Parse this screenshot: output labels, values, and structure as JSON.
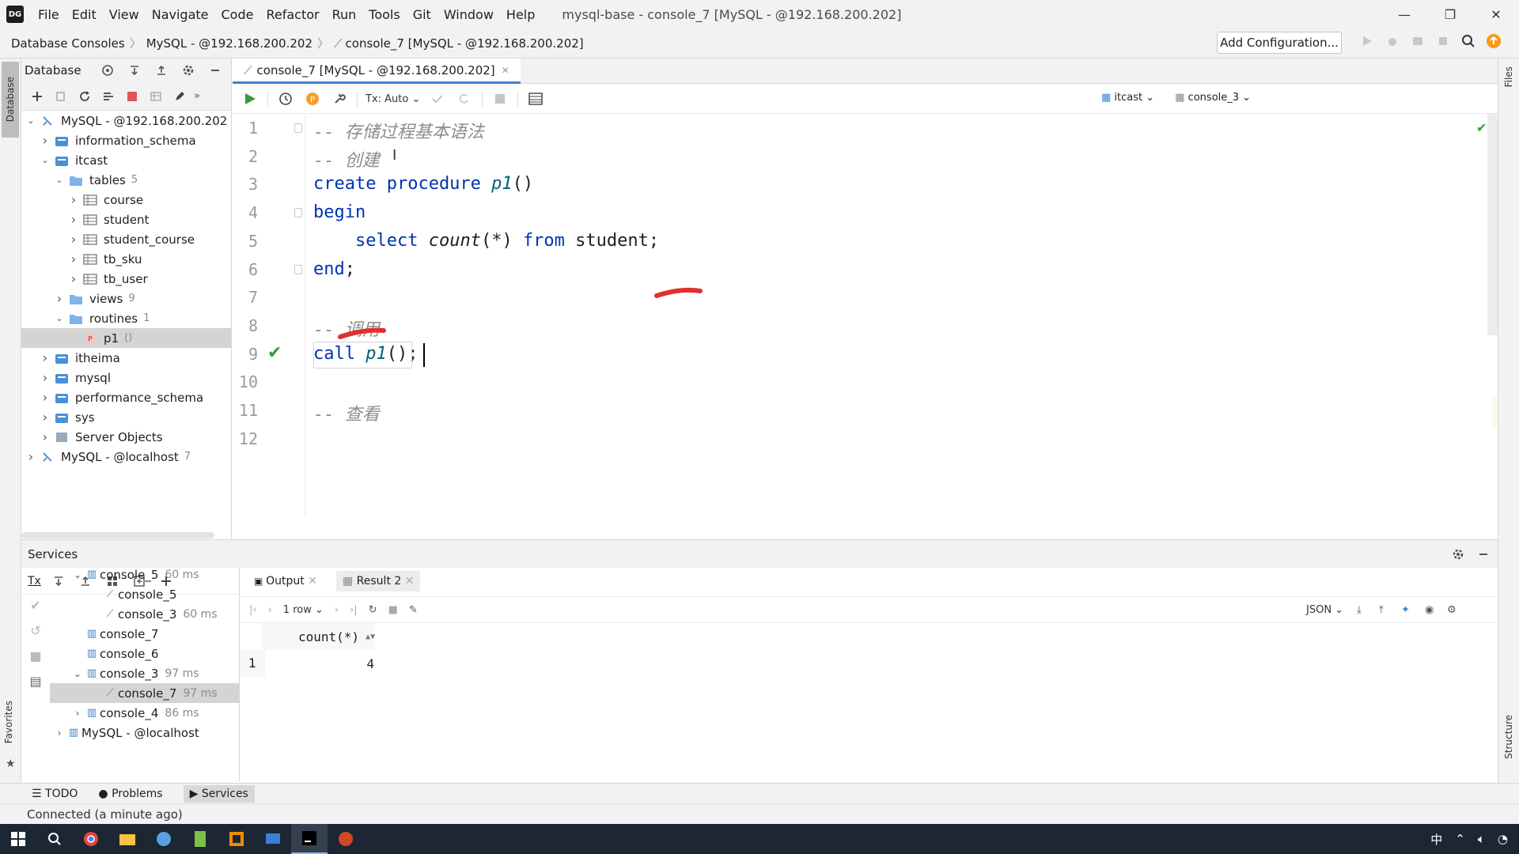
{
  "app": {
    "title": "mysql-base - console_7 [MySQL - @192.168.200.202]",
    "menu": [
      "File",
      "Edit",
      "View",
      "Navigate",
      "Code",
      "Refactor",
      "Run",
      "Tools",
      "Git",
      "Window",
      "Help"
    ],
    "logo_text": "DG"
  },
  "nav": {
    "breadcrumb": [
      "Database Consoles",
      "MySQL - @192.168.200.202",
      "console_7 [MySQL - @192.168.200.202]"
    ],
    "add_config": "Add Configuration..."
  },
  "stripes": {
    "left": "Database",
    "right_top": "Files",
    "right_bottom": "Structure",
    "favorites": "Favorites"
  },
  "db_panel": {
    "title": "Database",
    "tree": [
      {
        "label": "MySQL - @192.168.200.202",
        "level": 0,
        "arrow": "down",
        "icon": "datasource"
      },
      {
        "label": "information_schema",
        "level": 1,
        "arrow": "right",
        "icon": "schema"
      },
      {
        "label": "itcast",
        "level": 1,
        "arrow": "down",
        "icon": "schema"
      },
      {
        "label": "tables",
        "count": "5",
        "level": 2,
        "arrow": "down",
        "icon": "folder"
      },
      {
        "label": "course",
        "level": 3,
        "arrow": "right",
        "icon": "table"
      },
      {
        "label": "student",
        "level": 3,
        "arrow": "right",
        "icon": "table"
      },
      {
        "label": "student_course",
        "level": 3,
        "arrow": "right",
        "icon": "table"
      },
      {
        "label": "tb_sku",
        "level": 3,
        "arrow": "right",
        "icon": "table"
      },
      {
        "label": "tb_user",
        "level": 3,
        "arrow": "right",
        "icon": "table"
      },
      {
        "label": "views",
        "count": "9",
        "level": 2,
        "arrow": "right",
        "icon": "folder"
      },
      {
        "label": "routines",
        "count": "1",
        "level": 2,
        "arrow": "down",
        "icon": "folder"
      },
      {
        "label": "p1",
        "count": "()",
        "level": 3,
        "arrow": "",
        "icon": "procedure",
        "selected": true
      },
      {
        "label": "itheima",
        "level": 1,
        "arrow": "right",
        "icon": "schema"
      },
      {
        "label": "mysql",
        "level": 1,
        "arrow": "right",
        "icon": "schema"
      },
      {
        "label": "performance_schema",
        "level": 1,
        "arrow": "right",
        "icon": "schema"
      },
      {
        "label": "sys",
        "level": 1,
        "arrow": "right",
        "icon": "schema"
      },
      {
        "label": "Server Objects",
        "level": 1,
        "arrow": "right",
        "icon": "server"
      },
      {
        "label": "MySQL - @localhost",
        "count": "7",
        "level": 0,
        "arrow": "right",
        "icon": "datasource"
      }
    ]
  },
  "editor": {
    "tab": "console_7 [MySQL - @192.168.200.202]",
    "tx_mode": "Tx: Auto",
    "schema_select": "itcast",
    "session_select": "console_3",
    "lines": [
      {
        "n": "1",
        "segs": [
          {
            "t": "-- 存储过程基本语法",
            "c": "cm"
          }
        ]
      },
      {
        "n": "2",
        "segs": [
          {
            "t": "-- 创建",
            "c": "cm"
          }
        ]
      },
      {
        "n": "3",
        "segs": [
          {
            "t": "create procedure ",
            "c": "kw"
          },
          {
            "t": "p1",
            "c": "fn"
          },
          {
            "t": "()",
            "c": ""
          }
        ]
      },
      {
        "n": "4",
        "segs": [
          {
            "t": "begin",
            "c": "kw"
          }
        ]
      },
      {
        "n": "5",
        "segs": [
          {
            "t": "    select ",
            "c": "kw"
          },
          {
            "t": "count",
            "c": "fni"
          },
          {
            "t": "(",
            "c": ""
          },
          {
            "t": "*",
            "c": "it"
          },
          {
            "t": ") ",
            "c": ""
          },
          {
            "t": "from ",
            "c": "kw"
          },
          {
            "t": "student;",
            "c": ""
          }
        ]
      },
      {
        "n": "6",
        "segs": [
          {
            "t": "end",
            "c": "kw"
          },
          {
            "t": ";",
            "c": ""
          }
        ]
      },
      {
        "n": "7",
        "segs": []
      },
      {
        "n": "8",
        "segs": [
          {
            "t": "-- 调用",
            "c": "cm"
          }
        ]
      },
      {
        "n": "9",
        "segs": [
          {
            "t": "call ",
            "c": "kw"
          },
          {
            "t": "p1",
            "c": "fn"
          },
          {
            "t": "();",
            "c": ""
          }
        ]
      },
      {
        "n": "10",
        "segs": []
      },
      {
        "n": "11",
        "segs": [
          {
            "t": "-- 查看",
            "c": "cm"
          }
        ]
      },
      {
        "n": "12",
        "segs": []
      }
    ]
  },
  "services": {
    "title": "Services",
    "tx_label": "Tx",
    "tree": [
      {
        "label": "console_5",
        "time": "60 ms",
        "level": 1,
        "arrow": "down"
      },
      {
        "label": "console_5",
        "time": "",
        "level": 2,
        "arrow": ""
      },
      {
        "label": "console_3",
        "time": "60 ms",
        "level": 2,
        "arrow": ""
      },
      {
        "label": "console_7",
        "time": "",
        "level": 1,
        "arrow": ""
      },
      {
        "label": "console_6",
        "time": "",
        "level": 1,
        "arrow": ""
      },
      {
        "label": "console_3",
        "time": "97 ms",
        "level": 1,
        "arrow": "down"
      },
      {
        "label": "console_7",
        "time": "97 ms",
        "level": 2,
        "arrow": "",
        "selected": true
      },
      {
        "label": "console_4",
        "time": "86 ms",
        "level": 1,
        "arrow": "right"
      },
      {
        "label": "MySQL - @localhost",
        "time": "",
        "level": 0,
        "arrow": "right"
      }
    ],
    "tabs": [
      "Output",
      "Result 2"
    ],
    "rows_label": "1 row",
    "format": "JSON",
    "result": {
      "column": "count(*)",
      "row_num": "1",
      "value": "4"
    }
  },
  "toolwindows": [
    "TODO",
    "Problems",
    "Services"
  ],
  "status": "Connected (a minute ago)",
  "taskbar": {
    "ime": "中"
  }
}
